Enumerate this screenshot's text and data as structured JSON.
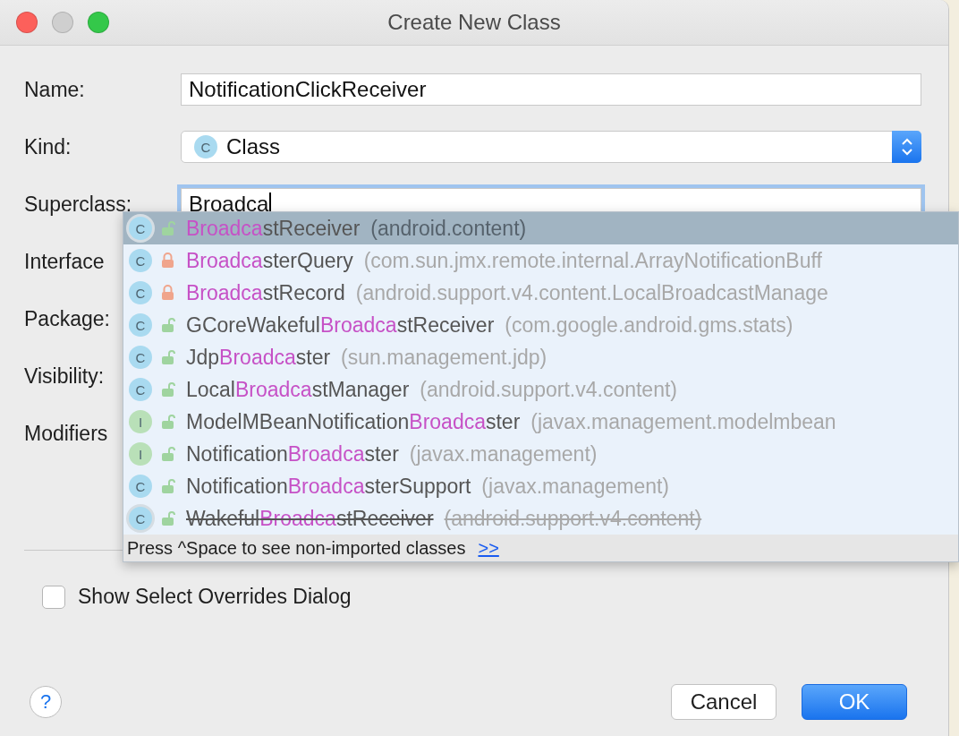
{
  "window": {
    "title": "Create New Class"
  },
  "form": {
    "name_label": "Name:",
    "name_value": "NotificationClickReceiver",
    "kind_label": "Kind:",
    "kind_badge": "C",
    "kind_value": "Class",
    "superclass_label": "Superclass:",
    "superclass_value": "Broadca",
    "interfaces_label": "Interface",
    "package_label": "Package:",
    "visibility_label": "Visibility:",
    "modifiers_label": "Modifiers"
  },
  "completion": {
    "items": [
      {
        "kind": "class",
        "badge": "C",
        "locked": false,
        "selected": true,
        "deprecated": false,
        "match": "Broadca",
        "after": "stReceiver",
        "package": "(android.content)"
      },
      {
        "kind": "class",
        "badge": "C",
        "locked": true,
        "selected": false,
        "deprecated": false,
        "match": "Broadca",
        "after": "sterQuery",
        "package": "(com.sun.jmx.remote.internal.ArrayNotificationBuff"
      },
      {
        "kind": "class",
        "badge": "C",
        "locked": true,
        "selected": false,
        "deprecated": false,
        "match": "Broadca",
        "after": "stRecord",
        "package": "(android.support.v4.content.LocalBroadcastManage"
      },
      {
        "kind": "class",
        "badge": "C",
        "locked": false,
        "selected": false,
        "deprecated": false,
        "before": "GCoreWakeful",
        "match": "Broadca",
        "after": "stReceiver",
        "package": "(com.google.android.gms.stats)"
      },
      {
        "kind": "class",
        "badge": "C",
        "locked": false,
        "selected": false,
        "deprecated": false,
        "before": "Jdp",
        "match": "Broadca",
        "after": "ster",
        "package": "(sun.management.jdp)"
      },
      {
        "kind": "class",
        "badge": "C",
        "locked": false,
        "selected": false,
        "deprecated": false,
        "before": "Local",
        "match": "Broadca",
        "after": "stManager",
        "package": "(android.support.v4.content)"
      },
      {
        "kind": "interface",
        "badge": "I",
        "locked": false,
        "selected": false,
        "deprecated": false,
        "before": "ModelMBeanNotification",
        "match": "Broadca",
        "after": "ster",
        "package": "(javax.management.modelmbean"
      },
      {
        "kind": "interface",
        "badge": "I",
        "locked": false,
        "selected": false,
        "deprecated": false,
        "before": "Notification",
        "match": "Broadca",
        "after": "ster",
        "package": "(javax.management)"
      },
      {
        "kind": "class",
        "badge": "C",
        "locked": false,
        "selected": false,
        "deprecated": false,
        "before": "Notification",
        "match": "Broadca",
        "after": "sterSupport",
        "package": "(javax.management)"
      },
      {
        "kind": "class",
        "badge": "C",
        "locked": false,
        "selected": false,
        "deprecated": true,
        "before": "Wakeful",
        "match": "Broadca",
        "after": "stReceiver",
        "package": "(android.support.v4.content)"
      }
    ],
    "hint": "Press ^Space to see non-imported classes",
    "hint_link": ">>"
  },
  "overrides_checkbox": {
    "label": "Show Select Overrides Dialog",
    "checked": false
  },
  "help_button": "?",
  "buttons": [
    {
      "kind": "secondary",
      "label": "Cancel"
    },
    {
      "kind": "primary",
      "label": "OK"
    }
  ]
}
